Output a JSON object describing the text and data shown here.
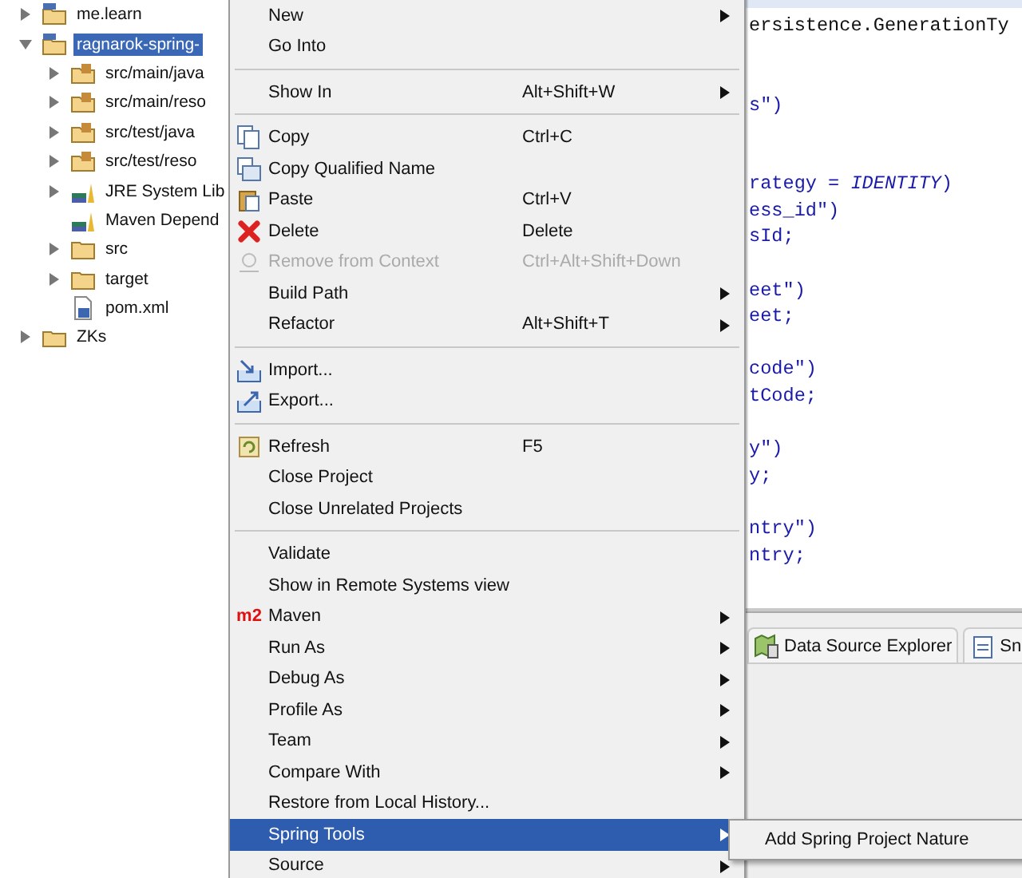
{
  "tree": [
    {
      "label": "me.learn",
      "kind": "project",
      "expanded": false,
      "selected": false
    },
    {
      "label": "ragnarok-spring-",
      "kind": "project",
      "expanded": true,
      "selected": true,
      "children": [
        {
          "label": "src/main/java",
          "kind": "package",
          "expandable": true
        },
        {
          "label": "src/main/reso",
          "kind": "package",
          "expandable": true
        },
        {
          "label": "src/test/java",
          "kind": "package",
          "expandable": true
        },
        {
          "label": "src/test/reso",
          "kind": "package",
          "expandable": true
        },
        {
          "label": "JRE System Lib",
          "kind": "library",
          "expandable": true
        },
        {
          "label": "Maven Depend",
          "kind": "library",
          "expandable": false
        },
        {
          "label": "src",
          "kind": "folder",
          "expandable": true
        },
        {
          "label": "target",
          "kind": "folder",
          "expandable": true
        },
        {
          "label": "pom.xml",
          "kind": "pom",
          "expandable": false
        }
      ]
    },
    {
      "label": "ZKs",
      "kind": "folder-project",
      "expanded": false,
      "selected": false
    }
  ],
  "editor": {
    "code_blocks": [
      [
        "ersistence.GenerationTy"
      ],
      [
        "s\")"
      ],
      [
        "rategy = *IDENTITY*)",
        "ess_id\")",
        "sId;"
      ],
      [
        "eet\")",
        "eet;"
      ],
      [
        "code\")",
        "tCode;"
      ],
      [
        "y\")",
        "y;"
      ],
      [
        "ntry\")",
        "ntry;"
      ]
    ]
  },
  "bottom_tabs": [
    {
      "label": "Data Source Explorer",
      "selected": false
    },
    {
      "label": "Sn",
      "selected": false
    }
  ],
  "context_menu": [
    {
      "kind": "item",
      "label": "New",
      "submenu": true,
      "disabled": false,
      "selected": false
    },
    {
      "kind": "item",
      "label": "Go Into",
      "submenu": false,
      "disabled": false,
      "selected": false
    },
    {
      "kind": "separator"
    },
    {
      "kind": "item",
      "label": "Show In",
      "shortcut": "Alt+Shift+W",
      "submenu": true,
      "disabled": false,
      "selected": false
    },
    {
      "kind": "separator"
    },
    {
      "kind": "item",
      "label": "Copy",
      "shortcut": "Ctrl+C",
      "submenu": false,
      "disabled": false,
      "selected": false
    },
    {
      "kind": "item",
      "label": "Copy Qualified Name",
      "submenu": false,
      "disabled": false,
      "selected": false
    },
    {
      "kind": "item",
      "label": "Paste",
      "shortcut": "Ctrl+V",
      "submenu": false,
      "disabled": false,
      "selected": false
    },
    {
      "kind": "item",
      "label": "Delete",
      "shortcut": "Delete",
      "submenu": false,
      "disabled": false,
      "selected": false
    },
    {
      "kind": "item",
      "label": "Remove from Context",
      "shortcut": "Ctrl+Alt+Shift+Down",
      "submenu": false,
      "disabled": true,
      "selected": false
    },
    {
      "kind": "item",
      "label": "Build Path",
      "submenu": true,
      "disabled": false,
      "selected": false
    },
    {
      "kind": "item",
      "label": "Refactor",
      "shortcut": "Alt+Shift+T",
      "submenu": true,
      "disabled": false,
      "selected": false
    },
    {
      "kind": "separator"
    },
    {
      "kind": "item",
      "label": "Import...",
      "submenu": false,
      "disabled": false,
      "selected": false
    },
    {
      "kind": "item",
      "label": "Export...",
      "submenu": false,
      "disabled": false,
      "selected": false
    },
    {
      "kind": "separator"
    },
    {
      "kind": "item",
      "label": "Refresh",
      "shortcut": "F5",
      "submenu": false,
      "disabled": false,
      "selected": false
    },
    {
      "kind": "item",
      "label": "Close Project",
      "submenu": false,
      "disabled": false,
      "selected": false
    },
    {
      "kind": "item",
      "label": "Close Unrelated Projects",
      "submenu": false,
      "disabled": false,
      "selected": false
    },
    {
      "kind": "separator"
    },
    {
      "kind": "item",
      "label": "Validate",
      "submenu": false,
      "disabled": false,
      "selected": false
    },
    {
      "kind": "item",
      "label": "Show in Remote Systems view",
      "submenu": false,
      "disabled": false,
      "selected": false
    },
    {
      "kind": "item",
      "label": "Maven",
      "icon_text": "m2",
      "submenu": true,
      "disabled": false,
      "selected": false
    },
    {
      "kind": "item",
      "label": "Run As",
      "submenu": true,
      "disabled": false,
      "selected": false
    },
    {
      "kind": "item",
      "label": "Debug As",
      "submenu": true,
      "disabled": false,
      "selected": false
    },
    {
      "kind": "item",
      "label": "Profile As",
      "submenu": true,
      "disabled": false,
      "selected": false
    },
    {
      "kind": "item",
      "label": "Team",
      "submenu": true,
      "disabled": false,
      "selected": false
    },
    {
      "kind": "item",
      "label": "Compare With",
      "submenu": true,
      "disabled": false,
      "selected": false
    },
    {
      "kind": "item",
      "label": "Restore from Local History...",
      "submenu": false,
      "disabled": false,
      "selected": false
    },
    {
      "kind": "item",
      "label": "Spring Tools",
      "submenu": true,
      "disabled": false,
      "selected": true
    },
    {
      "kind": "item",
      "label": "Source",
      "submenu": true,
      "disabled": false,
      "selected": false
    }
  ],
  "submenu": [
    {
      "label": "Add Spring Project Nature",
      "selected": false
    }
  ]
}
